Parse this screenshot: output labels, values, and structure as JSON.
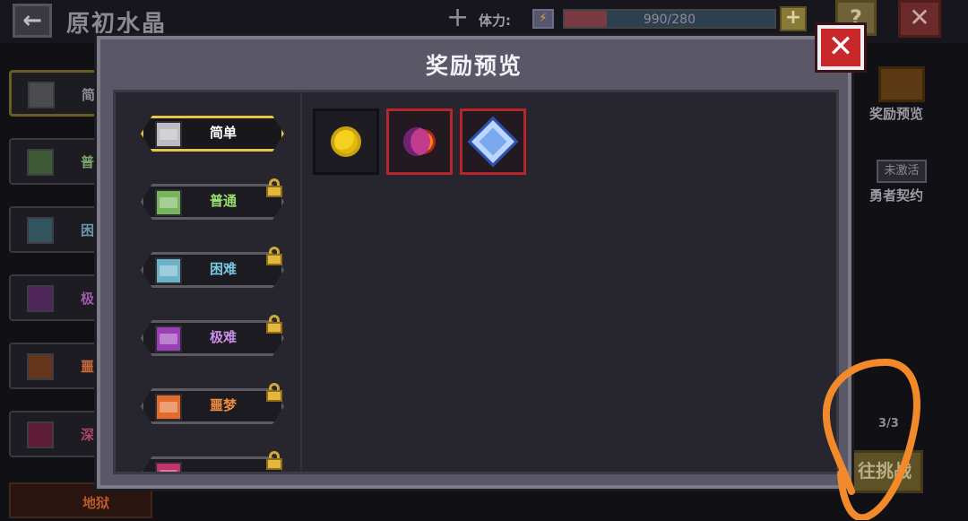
{
  "header": {
    "back_icon": "arrow-left-icon",
    "title": "原初水晶",
    "stamina_label": "体力:",
    "stamina_icon": "lightning-icon",
    "stamina_text": "990/280",
    "stamina_fill_fraction": 0.2,
    "stamina_plus": "+",
    "help": "?",
    "close": "✕"
  },
  "background": {
    "list_labels": [
      "简",
      "普",
      "困",
      "极",
      "噩",
      "深"
    ],
    "list_colors": [
      "#8f8e95",
      "#79a36a",
      "#6a96a8",
      "#9f5ba8",
      "#c86a3a",
      "#b04869"
    ],
    "hell_label": "地狱",
    "reward_preview_label": "奖励预览",
    "contract_status": "未激活",
    "contract_label": "勇者契约",
    "count": "3/3",
    "go_label": "往挑战"
  },
  "modal": {
    "title": "奖励预览",
    "close_icon": "close-icon",
    "difficulties": [
      {
        "label": "简单",
        "color": "#ffffff",
        "face": "#bcbcc2",
        "locked": false,
        "selected": true
      },
      {
        "label": "普通",
        "color": "#9be06f",
        "face": "#77b45c",
        "locked": true,
        "selected": false
      },
      {
        "label": "困难",
        "color": "#76c8e0",
        "face": "#69b2c8",
        "locked": true,
        "selected": false
      },
      {
        "label": "极难",
        "color": "#c98de8",
        "face": "#9a3fb6",
        "locked": true,
        "selected": false
      },
      {
        "label": "噩梦",
        "color": "#f08a3e",
        "face": "#e46b2a",
        "locked": true,
        "selected": false
      },
      {
        "label": "",
        "color": "#ff5a85",
        "face": "#c2356a",
        "locked": true,
        "selected": false
      }
    ],
    "rewards": [
      {
        "icon": "gold-coin-icon",
        "rarity": "common"
      },
      {
        "icon": "moon-sun-icon",
        "rarity": "rare"
      },
      {
        "icon": "crystal-icon",
        "rarity": "rare"
      }
    ]
  }
}
